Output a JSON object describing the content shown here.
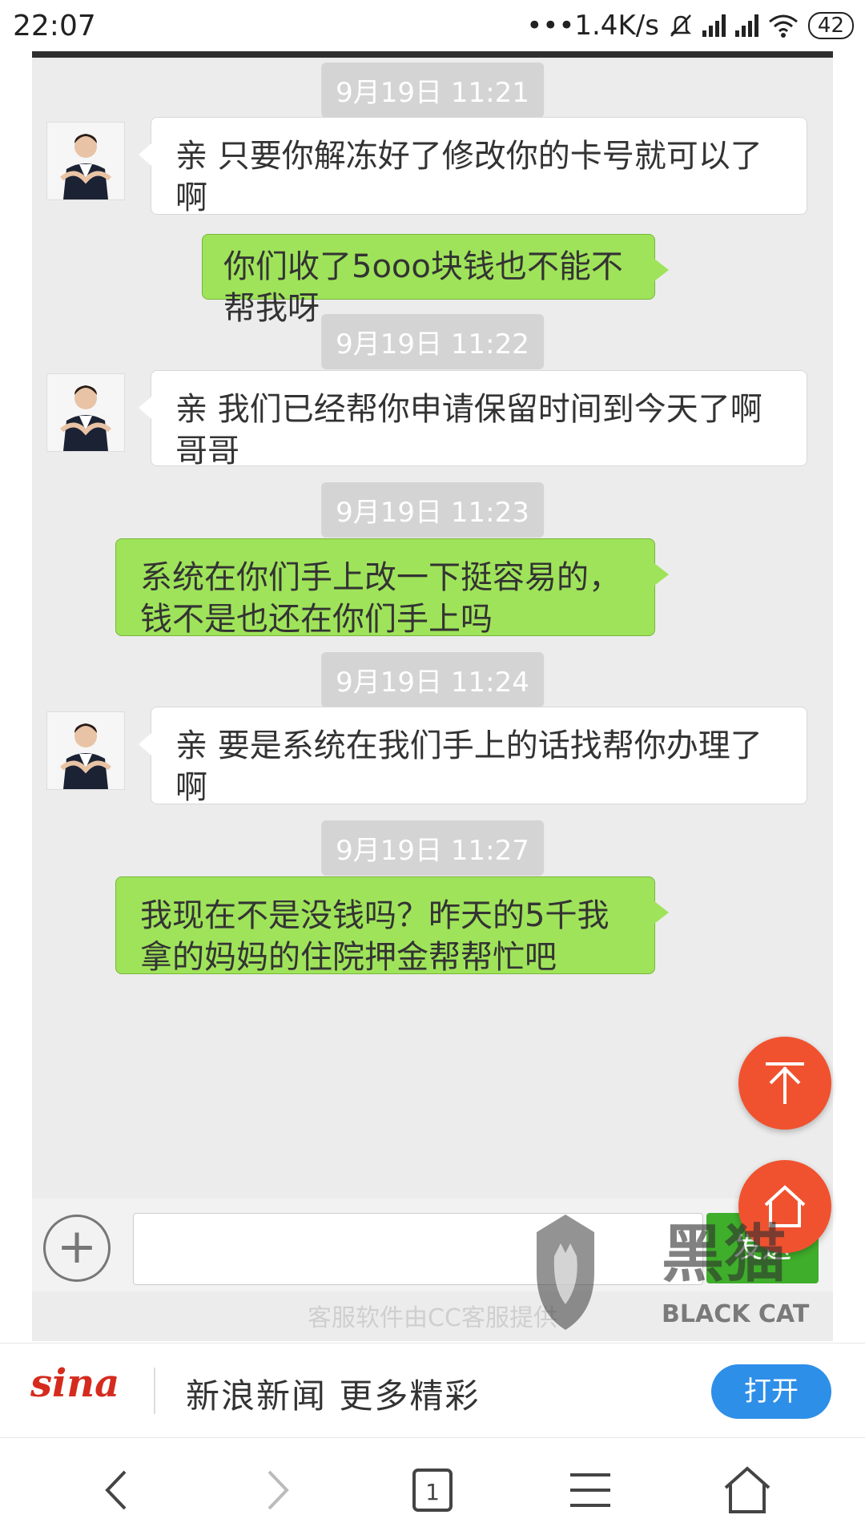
{
  "status_bar": {
    "time": "22:07",
    "net_speed": "•••1.4K/s",
    "battery": "42"
  },
  "chat": {
    "messages": [
      {
        "type": "time",
        "text": "9月19日 11:21"
      },
      {
        "type": "in",
        "text": "亲 只要你解冻好了修改你的卡号就可以了啊"
      },
      {
        "type": "out",
        "text": "你们收了5ooo块钱也不能不帮我呀"
      },
      {
        "type": "time",
        "text": "9月19日 11:22"
      },
      {
        "type": "in",
        "text": "亲 我们已经帮你申请保留时间到今天了啊 哥哥"
      },
      {
        "type": "time",
        "text": "9月19日 11:23"
      },
      {
        "type": "out",
        "text": "系统在你们手上改一下挺容易的，钱不是也还在你们手上吗"
      },
      {
        "type": "time",
        "text": "9月19日 11:24"
      },
      {
        "type": "in",
        "text": "亲 要是系统在我们手上的话找帮你办理了啊"
      },
      {
        "type": "time",
        "text": "9月19日 11:27"
      },
      {
        "type": "out",
        "text": "我现在不是没钱吗？昨天的5千我拿的妈妈的住院押金帮帮忙吧"
      }
    ],
    "send_label": "发送",
    "footer_note": "客服软件由CC客服提供"
  },
  "watermark": {
    "brand_cn": "黑猫",
    "brand_en": "BLACK CAT"
  },
  "sina_bar": {
    "logo": "sina",
    "tagline": "新浪新闻 更多精彩",
    "open_label": "打开"
  },
  "nav": {
    "tab_count": "1"
  },
  "colors": {
    "outgoing_bubble": "#9fe35a",
    "fab": "#f0522f",
    "open_button": "#2e8fe8",
    "sina_red": "#d52b1e"
  }
}
